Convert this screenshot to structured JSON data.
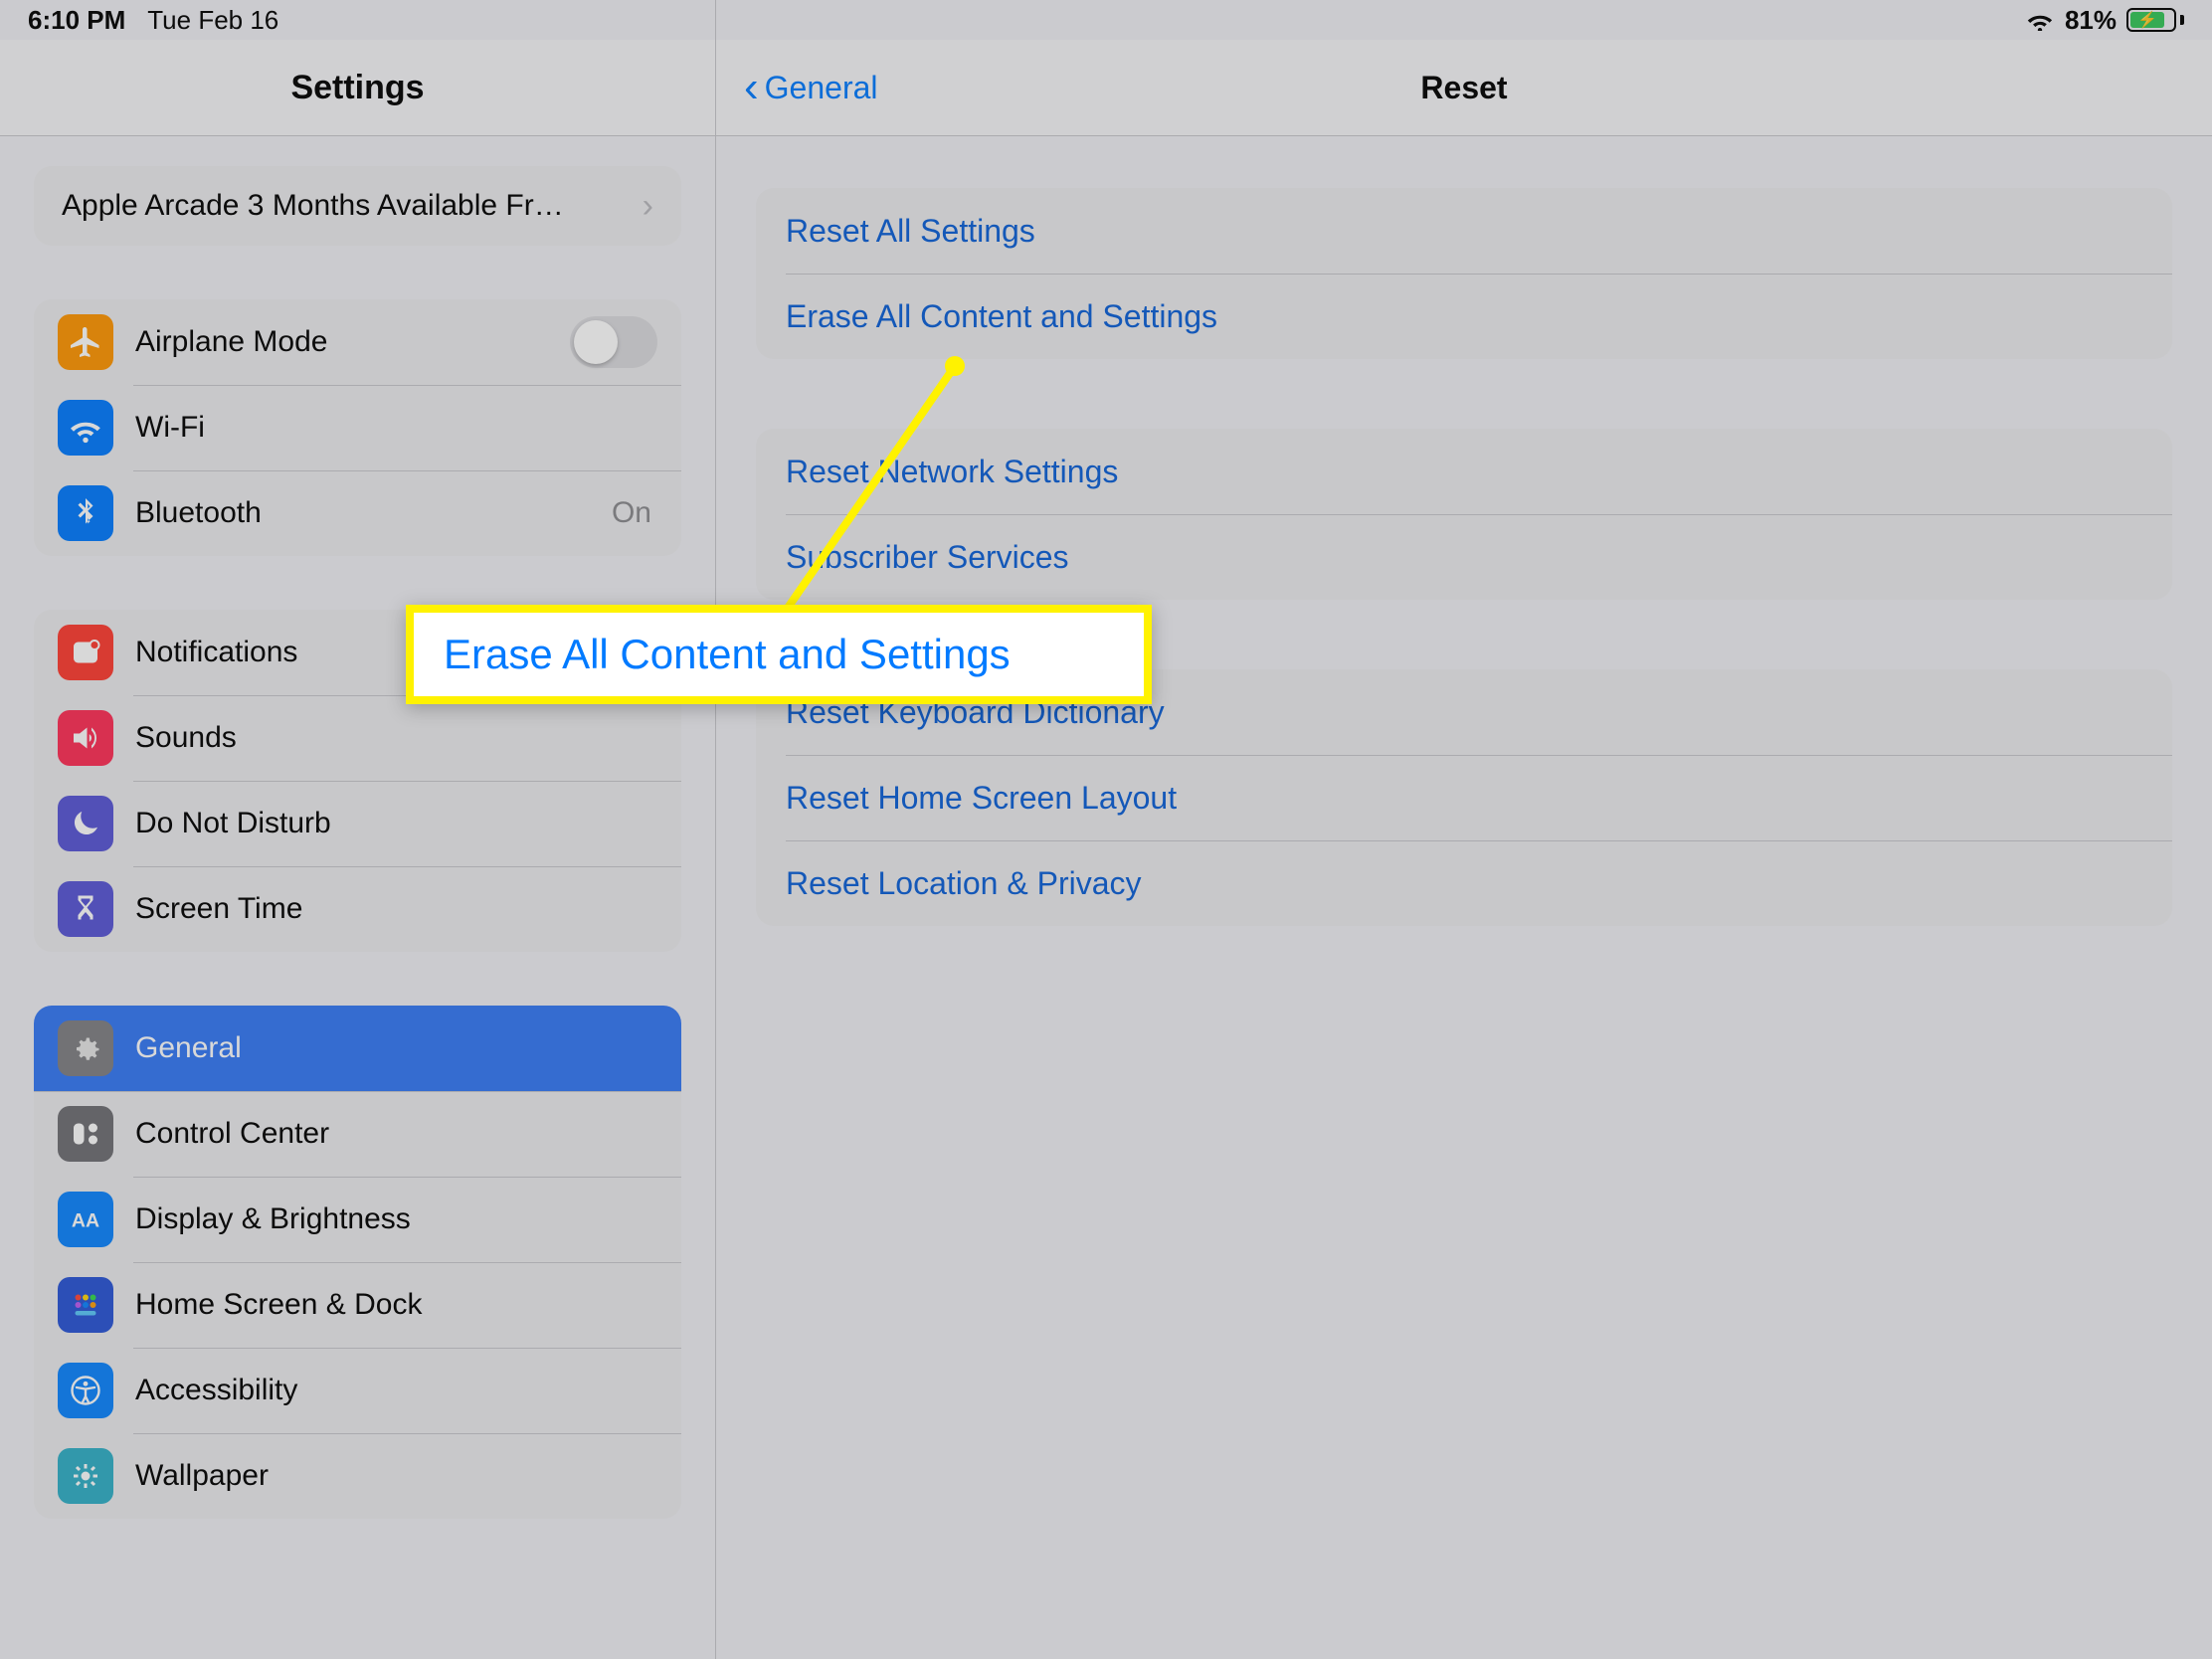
{
  "status": {
    "time": "6:10 PM",
    "date": "Tue Feb 16",
    "battery_percent": "81%"
  },
  "sidebar": {
    "title": "Settings",
    "promo": "Apple Arcade 3 Months Available Fr…",
    "airplane_mode": "Airplane Mode",
    "wifi": "Wi-Fi",
    "bluetooth": "Bluetooth",
    "bluetooth_value": "On",
    "notifications": "Notifications",
    "sounds": "Sounds",
    "do_not_disturb": "Do Not Disturb",
    "screen_time": "Screen Time",
    "general": "General",
    "control_center": "Control Center",
    "display_brightness": "Display & Brightness",
    "home_screen_dock": "Home Screen & Dock",
    "accessibility": "Accessibility",
    "wallpaper": "Wallpaper"
  },
  "detail": {
    "back_label": "General",
    "title": "Reset",
    "group1": {
      "reset_all_settings": "Reset All Settings",
      "erase_all": "Erase All Content and Settings"
    },
    "group2": {
      "reset_network": "Reset Network Settings",
      "subscriber_services": "Subscriber Services"
    },
    "group3": {
      "reset_keyboard": "Reset Keyboard Dictionary",
      "reset_home": "Reset Home Screen Layout",
      "reset_location": "Reset Location & Privacy"
    }
  },
  "annotation": {
    "label": "Erase All Content and Settings"
  },
  "colors": {
    "link": "#007aff",
    "highlight": "#fff200",
    "selected_bg": "#3478f6"
  }
}
